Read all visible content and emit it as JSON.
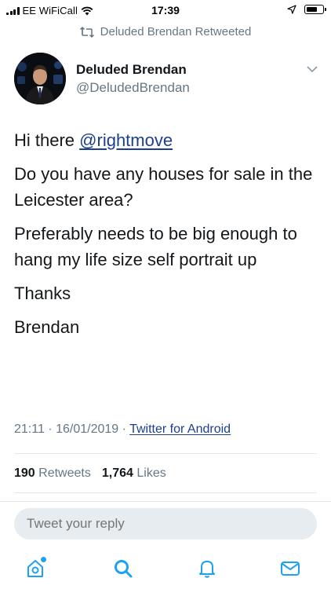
{
  "status_bar": {
    "carrier": "EE WiFiCall",
    "time": "17:39"
  },
  "retweet_context": {
    "text": "Deluded Brendan Retweeted"
  },
  "tweet": {
    "author": {
      "display_name": "Deluded Brendan",
      "handle": "@DeludedBrendan"
    },
    "greeting": "Hi there ",
    "mention": "@rightmove",
    "paragraphs": [
      "Do you have any houses for sale in the Leicester area?",
      "Preferably needs to be big enough to hang my life size self portrait up",
      "Thanks",
      "Brendan"
    ],
    "time": "21:11",
    "date": "16/01/2019",
    "separator": " · ",
    "source": "Twitter for Android",
    "retweets_count": "190",
    "retweets_label": "Retweets",
    "likes_count": "1,764",
    "likes_label": "Likes"
  },
  "reply": {
    "placeholder": "Tweet your reply"
  },
  "tab_bar": {
    "accent_color": "#1da1f2",
    "icons": [
      "home-icon",
      "search-icon",
      "notifications-icon",
      "messages-icon"
    ]
  }
}
